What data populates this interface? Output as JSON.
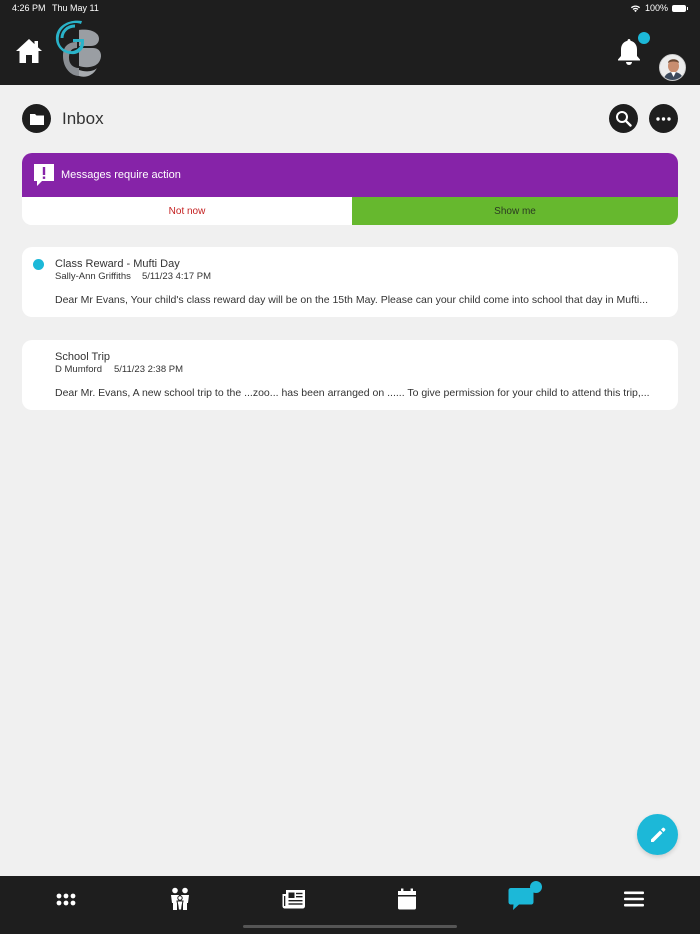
{
  "status_bar": {
    "time": "4:26 PM",
    "date": "Thu May 11",
    "battery": "100%",
    "icons": [
      "wifi-icon",
      "battery-icon"
    ]
  },
  "header": {
    "icons": [
      "home-icon",
      "school-logo",
      "bell-icon",
      "avatar"
    ],
    "notification_badge": true
  },
  "inbox": {
    "title": "Inbox",
    "icons": [
      "folder-icon",
      "search-icon",
      "more-icon"
    ]
  },
  "action_banner": {
    "message": "Messages require action",
    "not_now_label": "Not now",
    "show_me_label": "Show me",
    "colors": {
      "banner": "#8623a8",
      "show_me": "#66b82e",
      "not_now_text": "#c42020"
    }
  },
  "messages": [
    {
      "subject": "Class Reward - Mufti Day",
      "sender": "Sally-Ann Griffiths",
      "datetime": "5/11/23 4:17 PM",
      "preview": "Dear Mr Evans, Your child's class reward day will be on the 15th May. Please can your child come into school that day in Mufti...",
      "unread": true
    },
    {
      "subject": "School Trip",
      "sender": "D Mumford",
      "datetime": "5/11/23 2:38 PM",
      "preview": "Dear Mr. Evans, A new school trip to the ...zoo... has been arranged on ...... To give permission for your child to attend this trip,...",
      "unread": false
    }
  ],
  "compose": {
    "icon": "pencil-icon",
    "color": "#1cb8d8"
  },
  "tab_bar": {
    "tabs": [
      "apps-icon",
      "family-icon",
      "news-icon",
      "calendar-icon",
      "messages-icon",
      "menu-icon"
    ],
    "active": "messages-icon",
    "accent": "#1cb8d8"
  }
}
